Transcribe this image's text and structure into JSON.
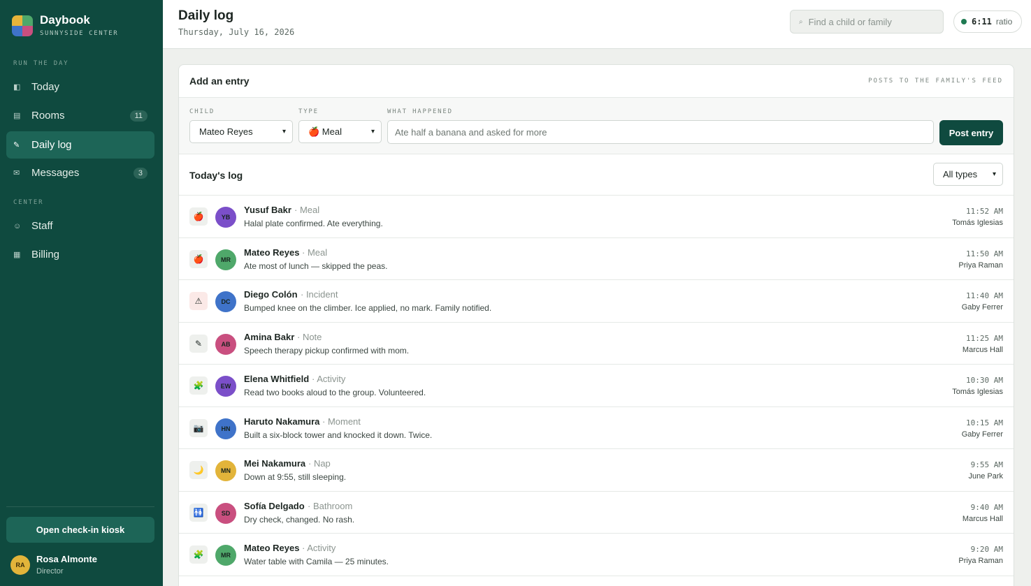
{
  "brand": {
    "name": "Daybook",
    "subtitle": "SUNNYSIDE CENTER"
  },
  "nav": {
    "section_run": "RUN THE DAY",
    "section_center": "CENTER",
    "items": [
      {
        "label": "Today",
        "icon": "today-icon"
      },
      {
        "label": "Rooms",
        "icon": "rooms-icon",
        "count": "11"
      },
      {
        "label": "Daily log",
        "icon": "pencil-icon",
        "active": true
      },
      {
        "label": "Messages",
        "icon": "envelope-icon",
        "count": "3"
      },
      {
        "label": "Staff",
        "icon": "staff-icon"
      },
      {
        "label": "Billing",
        "icon": "billing-icon"
      }
    ],
    "kiosk_button": "Open check-in kiosk"
  },
  "user": {
    "initials": "RA",
    "name": "Rosa Almonte",
    "role": "Director"
  },
  "header": {
    "title": "Daily log",
    "date": "Thursday, July 16, 2026",
    "search_placeholder": "Find a child or family",
    "ratio_value": "6:11",
    "ratio_label": "ratio"
  },
  "entry_form": {
    "title": "Add an entry",
    "note": "POSTS TO THE FAMILY'S FEED",
    "child_label": "CHILD",
    "child_value": "Mateo Reyes",
    "type_label": "TYPE",
    "type_value": "🍎 Meal",
    "what_label": "WHAT HAPPENED",
    "what_placeholder": "Ate half a banana and asked for more",
    "post_button": "Post entry"
  },
  "log": {
    "title": "Today's log",
    "filter_value": "All types",
    "entries": [
      {
        "glyph": "🍎",
        "icon": "apple-icon",
        "initials": "YB",
        "avatar_color": "#7b4fc9",
        "name": "Yusuf Bakr",
        "type": "Meal",
        "text": "Halal plate confirmed. Ate everything.",
        "time": "11:52 AM",
        "by": "Tomás Iglesias"
      },
      {
        "glyph": "🍎",
        "icon": "apple-icon",
        "initials": "MR",
        "avatar_color": "#4fa86a",
        "name": "Mateo Reyes",
        "type": "Meal",
        "text": "Ate most of lunch — skipped the peas.",
        "time": "11:50 AM",
        "by": "Priya Raman"
      },
      {
        "glyph": "⚠",
        "icon": "warning-icon",
        "initials": "DC",
        "avatar_color": "#3f73c9",
        "name": "Diego Colón",
        "type": "Incident",
        "text": "Bumped knee on the climber. Ice applied, no mark. Family notified.",
        "time": "11:40 AM",
        "by": "Gaby Ferrer"
      },
      {
        "glyph": "✎",
        "icon": "pencil-icon",
        "initials": "AB",
        "avatar_color": "#c94f7f",
        "name": "Amina Bakr",
        "type": "Note",
        "text": "Speech therapy pickup confirmed with mom.",
        "time": "11:25 AM",
        "by": "Marcus Hall"
      },
      {
        "glyph": "🧩",
        "icon": "puzzle-icon",
        "initials": "EW",
        "avatar_color": "#7b4fc9",
        "name": "Elena Whitfield",
        "type": "Activity",
        "text": "Read two books aloud to the group. Volunteered.",
        "time": "10:30 AM",
        "by": "Tomás Iglesias"
      },
      {
        "glyph": "📷",
        "icon": "camera-icon",
        "initials": "HN",
        "avatar_color": "#3f73c9",
        "name": "Haruto Nakamura",
        "type": "Moment",
        "text": "Built a six-block tower and knocked it down. Twice.",
        "time": "10:15 AM",
        "by": "Gaby Ferrer"
      },
      {
        "glyph": "🌙",
        "icon": "moon-icon",
        "initials": "MN",
        "avatar_color": "#e2b43a",
        "name": "Mei Nakamura",
        "type": "Nap",
        "text": "Down at 9:55, still sleeping.",
        "time": "9:55 AM",
        "by": "June Park"
      },
      {
        "glyph": "🚻",
        "icon": "restroom-icon",
        "initials": "SD",
        "avatar_color": "#c94f7f",
        "name": "Sofía Delgado",
        "type": "Bathroom",
        "text": "Dry check, changed. No rash.",
        "time": "9:40 AM",
        "by": "Marcus Hall"
      },
      {
        "glyph": "🧩",
        "icon": "puzzle-icon",
        "initials": "MR",
        "avatar_color": "#4fa86a",
        "name": "Mateo Reyes",
        "type": "Activity",
        "text": "Water table with Camila — 25 minutes.",
        "time": "9:20 AM",
        "by": "Priya Raman"
      }
    ]
  }
}
